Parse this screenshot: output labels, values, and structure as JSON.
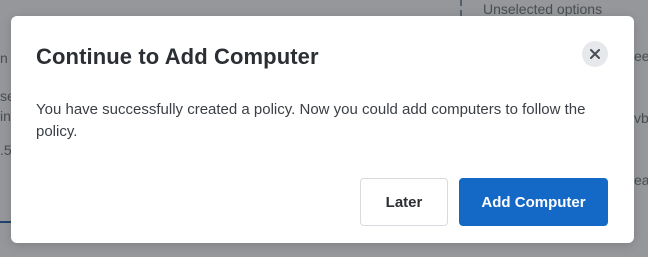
{
  "background": {
    "top_right_label": "Unselected options",
    "right_fragments": [
      "ee",
      "vb",
      "ea"
    ],
    "left_fragments": [
      "n a",
      "se",
      "in",
      ".5"
    ]
  },
  "modal": {
    "title": "Continue to Add Computer",
    "body": "You have successfully created a policy. Now you could add computers to follow the policy.",
    "close_icon": "close-icon",
    "buttons": {
      "later_label": "Later",
      "add_computer_label": "Add Computer"
    }
  },
  "colors": {
    "primary": "#1469c7",
    "overlay": "#212529"
  }
}
